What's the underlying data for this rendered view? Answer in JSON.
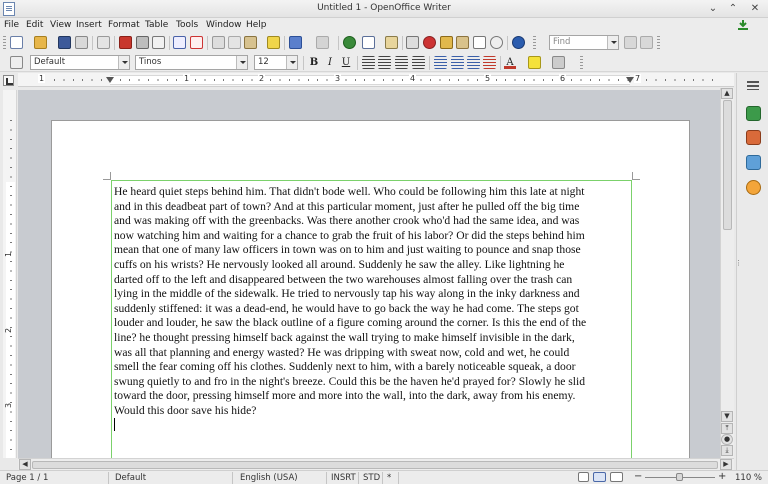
{
  "window": {
    "title": "Untitled 1 - OpenOffice Writer",
    "minimize_glyph": "⌄",
    "maximize_glyph": "⌃",
    "close_glyph": "✕"
  },
  "menu": {
    "items": [
      "File",
      "Edit",
      "View",
      "Insert",
      "Format",
      "Table",
      "Tools",
      "Window",
      "Help"
    ]
  },
  "standard_toolbar": {
    "find_placeholder": "Find"
  },
  "formatting_toolbar": {
    "paragraph_style": "Default",
    "font_name": "Tinos",
    "font_size": "12",
    "bold_label": "B",
    "italic_label": "I",
    "underline_label": "U",
    "font_color_label": "A"
  },
  "ruler": {
    "numbers": [
      "1",
      "1",
      "2",
      "3",
      "4",
      "5",
      "6",
      "7"
    ]
  },
  "vruler": {
    "numbers": [
      "1",
      "2",
      "3"
    ]
  },
  "document": {
    "lines": [
      "He heard quiet steps behind him. That didn't bode well. Who could be following him this late at night",
      "and in this deadbeat part of town? And at this particular moment, just after he pulled off the big time",
      "and was making off with the greenbacks. Was there another crook who'd had the same idea, and was",
      "now watching him and waiting for a chance to grab the fruit of his labor? Or did the steps behind him",
      "mean that one of many law officers in town was on to him and just waiting to pounce and snap those",
      "cuffs on his wrists? He nervously looked all around. Suddenly he saw the alley. Like lightning he",
      "darted off to the left and disappeared between the two warehouses almost falling over the trash can",
      "lying in the middle of the sidewalk. He tried to nervously tap his way along in the inky darkness and",
      "suddenly stiffened: it was a dead-end, he would have to go back the way he had come. The steps got",
      "louder and louder, he saw the black outline of a figure coming around the corner. Is this the end of the",
      "line? he thought pressing himself back against the wall trying to make himself invisible in the dark,",
      "was all that planning and energy wasted? He was dripping with sweat now, cold and wet, he could",
      "smell the fear coming off his clothes. Suddenly next to him, with a barely noticeable squeak, a door",
      "swung quietly to and fro in the night's breeze. Could this be the haven he'd prayed for? Slowly he slid",
      "toward the door, pressing himself more and more into the wall, into the dark, away from his enemy.",
      "Would this door save his hide?"
    ]
  },
  "statusbar": {
    "page": "Page 1 / 1",
    "style": "Default",
    "language": "English (USA)",
    "insert_mode": "INSRT",
    "selection_mode": "STD",
    "modified": "*",
    "zoom": "110 %"
  },
  "colors": {
    "frame_border": "#7bd16b",
    "doc_background": "#c8cbd0"
  }
}
